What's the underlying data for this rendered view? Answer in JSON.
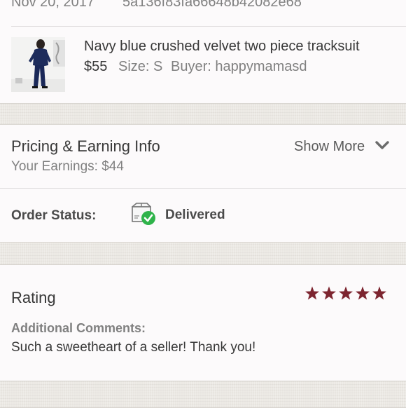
{
  "order_header": {
    "date": "Nov 20, 2017",
    "order_id": "5a136f83fa66648b42082e68"
  },
  "item": {
    "title": "Navy blue crushed velvet two piece tracksuit",
    "price": "$55",
    "size": "Size: S",
    "buyer": "Buyer: happymamasd"
  },
  "pricing": {
    "heading": "Pricing & Earning Info",
    "earnings": "Your Earnings: $44",
    "show_more": "Show More"
  },
  "order_status": {
    "label": "Order Status:",
    "value": "Delivered"
  },
  "rating": {
    "heading": "Rating",
    "stars": 5,
    "comments_label": "Additional Comments:",
    "comment": "Such a sweetheart of a seller! Thank you!"
  },
  "colors": {
    "star": "#7d2530",
    "check": "#2fb34a"
  },
  "icons": {
    "show_more": "chevron-down-icon",
    "status": "package-delivered-icon",
    "rating": "star-icon"
  }
}
